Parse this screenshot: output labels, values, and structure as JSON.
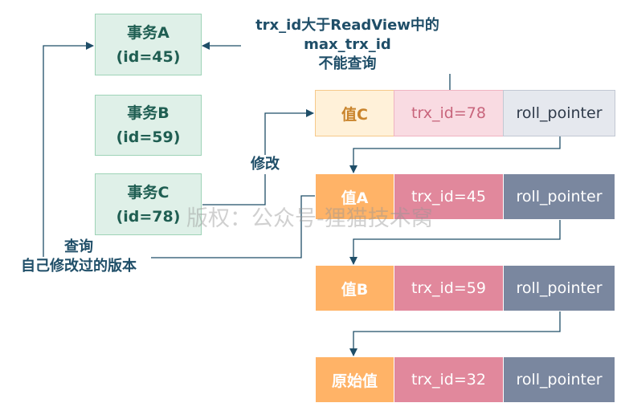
{
  "transactions": [
    {
      "name": "事务A",
      "id": "(id=45)"
    },
    {
      "name": "事务B",
      "id": "(id=59)"
    },
    {
      "name": "事务C",
      "id": "(id=78)"
    }
  ],
  "versions": [
    {
      "value": "值C",
      "trx_id": "trx_id=78",
      "pointer": "roll_pointer"
    },
    {
      "value": "值A",
      "trx_id": "trx_id=45",
      "pointer": "roll_pointer"
    },
    {
      "value": "值B",
      "trx_id": "trx_id=59",
      "pointer": "roll_pointer"
    },
    {
      "value": "原始值",
      "trx_id": "trx_id=32",
      "pointer": "roll_pointer"
    }
  ],
  "labels": {
    "top_line1": "trx_id大于ReadView中的",
    "top_line2": "max_trx_id",
    "top_line3": "不能查询",
    "modify": "修改",
    "query_line1": "查询",
    "query_line2": "自己修改过的版本"
  },
  "watermark": "版权：公众号-狸猫技术窝"
}
